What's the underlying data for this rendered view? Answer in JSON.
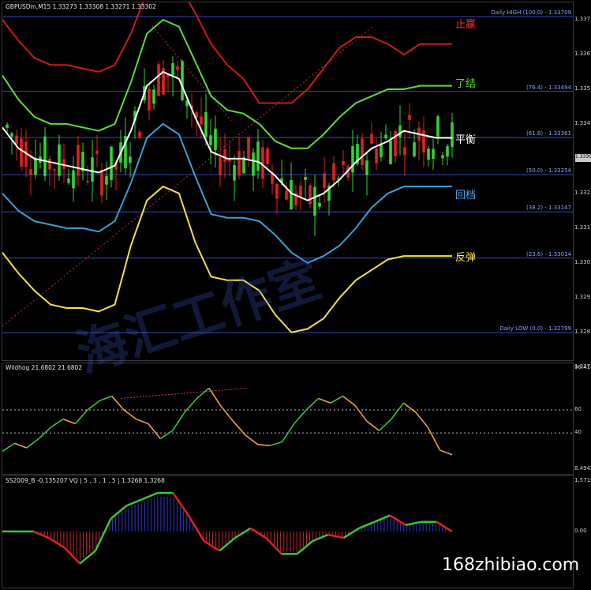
{
  "chart_data": [
    {
      "type": "line",
      "panel": "main",
      "title": "GBPUSDm,M15  1.33273  1.33308  1.33271  1.33302",
      "symbol": "GBPUSDm",
      "timeframe": "M15",
      "ohlc": [
        "1.33273",
        "1.33308",
        "1.33271",
        "1.33302"
      ],
      "ylim": [
        1.3272,
        1.3375
      ],
      "y_ticks": [
        "1.337",
        "1.336",
        "1.335",
        "1.334",
        "1.333",
        "1.332",
        "1.331",
        "1.330",
        "1.329",
        "1.328",
        "1.327"
      ],
      "current_price_tag": "1.3330",
      "levels": [
        {
          "label": "Daily HIGH (100.0) - 1.33709",
          "value": 1.33709
        },
        {
          "label": "(76.4) - 1.33494",
          "value": 1.33494
        },
        {
          "label": "(61.8) - 1.33361",
          "value": 1.33361
        },
        {
          "label": "(50.0) - 1.33254",
          "value": 1.33254
        },
        {
          "label": "(38.2) - 1.33147",
          "value": 1.33147
        },
        {
          "label": "(23.6) - 1.33014",
          "value": 1.33014
        },
        {
          "label": "Daily LOW (0.0) - 1.32799",
          "value": 1.32799
        }
      ],
      "band_labels": [
        {
          "text": "止赢",
          "color": "#ff3030"
        },
        {
          "text": "了结",
          "color": "#5ddc3a"
        },
        {
          "text": "平衡",
          "color": "#ffffff"
        },
        {
          "text": "回档",
          "color": "#4fa8e8"
        },
        {
          "text": "反弹",
          "color": "#ffe35a"
        }
      ],
      "series": [
        {
          "color": "#d01818",
          "values": [
            1.337,
            1.3364,
            1.3359,
            1.3357,
            1.3357,
            1.3356,
            1.3355,
            1.3357,
            1.3366,
            1.3378,
            1.3382,
            1.338,
            1.3372,
            1.3363,
            1.3357,
            1.3353,
            1.3346,
            1.3346,
            1.3346,
            1.335,
            1.3356,
            1.3362,
            1.3365,
            1.3365,
            1.3363,
            1.336,
            1.3363,
            1.3363,
            1.3363
          ]
        },
        {
          "color": "#5ddc3a",
          "values": [
            1.3354,
            1.3347,
            1.3342,
            1.334,
            1.334,
            1.3339,
            1.3338,
            1.334,
            1.3352,
            1.3366,
            1.337,
            1.3368,
            1.3358,
            1.3348,
            1.3344,
            1.3343,
            1.334,
            1.3335,
            1.3333,
            1.3333,
            1.3337,
            1.3342,
            1.3346,
            1.3348,
            1.335,
            1.335,
            1.3351,
            1.3351,
            1.3351
          ]
        },
        {
          "color": "#ffffff",
          "values": [
            1.3339,
            1.3333,
            1.333,
            1.3329,
            1.3328,
            1.3327,
            1.3326,
            1.3328,
            1.3338,
            1.3351,
            1.3355,
            1.3353,
            1.3342,
            1.3332,
            1.333,
            1.333,
            1.3329,
            1.3325,
            1.332,
            1.3318,
            1.332,
            1.3324,
            1.3329,
            1.3333,
            1.3335,
            1.3338,
            1.3337,
            1.3336,
            1.3336
          ]
        },
        {
          "color": "#3b9fd8",
          "values": [
            1.332,
            1.3315,
            1.3312,
            1.3311,
            1.331,
            1.331,
            1.3309,
            1.3312,
            1.3323,
            1.3336,
            1.334,
            1.3337,
            1.3325,
            1.3314,
            1.3313,
            1.3313,
            1.3312,
            1.3308,
            1.3303,
            1.33,
            1.3302,
            1.3305,
            1.331,
            1.3316,
            1.332,
            1.3322,
            1.3322,
            1.3322,
            1.3322
          ]
        },
        {
          "color": "#f2e14a",
          "values": [
            1.3303,
            1.3297,
            1.3292,
            1.3288,
            1.3287,
            1.3287,
            1.3286,
            1.3288,
            1.3305,
            1.3318,
            1.3322,
            1.332,
            1.3306,
            1.3296,
            1.3295,
            1.3295,
            1.3292,
            1.3285,
            1.328,
            1.3281,
            1.3284,
            1.329,
            1.3295,
            1.3298,
            1.3301,
            1.3302,
            1.3302,
            1.3302,
            1.3302
          ]
        }
      ]
    },
    {
      "type": "line",
      "panel": "wildhog",
      "title": "Wildhog 21.6802 21.6802",
      "ylim": [
        8.4942,
        96.4148
      ],
      "y_ticks": [
        "96.4148",
        "60",
        "40",
        "8.4942"
      ],
      "values": [
        24,
        31,
        27,
        35,
        45,
        52,
        48,
        60,
        68,
        72,
        60,
        52,
        48,
        35,
        42,
        58,
        70,
        79,
        63,
        50,
        38,
        30,
        29,
        32,
        48,
        60,
        70,
        66,
        72,
        64,
        50,
        42,
        52,
        66,
        58,
        45,
        25,
        21
      ]
    },
    {
      "type": "bar",
      "panel": "ss2009",
      "title": "SS2009_B -0.135207  VQ | 5 , 3 , 1 , 5  | 1.3268 1.3268",
      "ylim": [
        -1.6,
        1.571
      ],
      "y_ticks": [
        "1.5710",
        "0.00"
      ],
      "line_values": [
        0,
        0,
        0,
        -0.2,
        -0.5,
        -1.0,
        -0.6,
        0.4,
        0.8,
        1.0,
        1.2,
        1.2,
        0.5,
        -0.3,
        -0.6,
        -0.2,
        0.1,
        -0.2,
        -0.7,
        -0.7,
        -0.3,
        -0.1,
        -0.2,
        0.1,
        0.3,
        0.5,
        0.2,
        0.3,
        0.3,
        0.0
      ]
    }
  ],
  "watermark": "168zhibiao.com",
  "watermark_zh": "海汇工作室"
}
